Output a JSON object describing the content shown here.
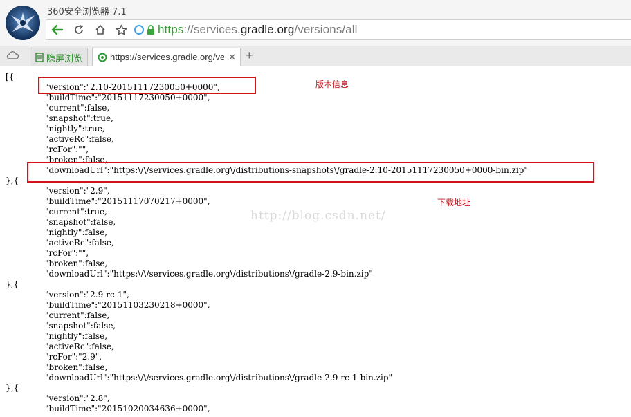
{
  "window": {
    "title": "360安全浏览器 7.1"
  },
  "address_bar": {
    "scheme": "https",
    "sep": "://",
    "sub": "services.",
    "domain": "gradle.org",
    "path": "/versions/all"
  },
  "tabs": [
    {
      "label": "隐屏浏览"
    },
    {
      "label": "https://services.gradle.org/versions/all",
      "close": "✕"
    }
  ],
  "new_tab_label": "+",
  "annotations": {
    "version_info": "版本信息",
    "download_url": "下载地址"
  },
  "watermark": "http://blog.csdn.net/",
  "json_lines": [
    "[{",
    "\"version\":\"2.10-20151117230050+0000\",",
    "\"buildTime\":\"20151117230050+0000\",",
    "\"current\":false,",
    "\"snapshot\":true,",
    "\"nightly\":true,",
    "\"activeRc\":false,",
    "\"rcFor\":\"\",",
    "\"broken\":false,",
    "\"downloadUrl\":\"https:\\/\\/services.gradle.org\\/distributions-snapshots\\/gradle-2.10-20151117230050+0000-bin.zip\"",
    "},{",
    "\"version\":\"2.9\",",
    "\"buildTime\":\"20151117070217+0000\",",
    "\"current\":true,",
    "\"snapshot\":false,",
    "\"nightly\":false,",
    "\"activeRc\":false,",
    "\"rcFor\":\"\",",
    "\"broken\":false,",
    "\"downloadUrl\":\"https:\\/\\/services.gradle.org\\/distributions\\/gradle-2.9-bin.zip\"",
    "},{",
    "\"version\":\"2.9-rc-1\",",
    "\"buildTime\":\"20151103230218+0000\",",
    "\"current\":false,",
    "\"snapshot\":false,",
    "\"nightly\":false,",
    "\"activeRc\":false,",
    "\"rcFor\":\"2.9\",",
    "\"broken\":false,",
    "\"downloadUrl\":\"https:\\/\\/services.gradle.org\\/distributions\\/gradle-2.9-rc-1-bin.zip\"",
    "},{",
    "\"version\":\"2.8\",",
    "\"buildTime\":\"20151020034636+0000\","
  ]
}
